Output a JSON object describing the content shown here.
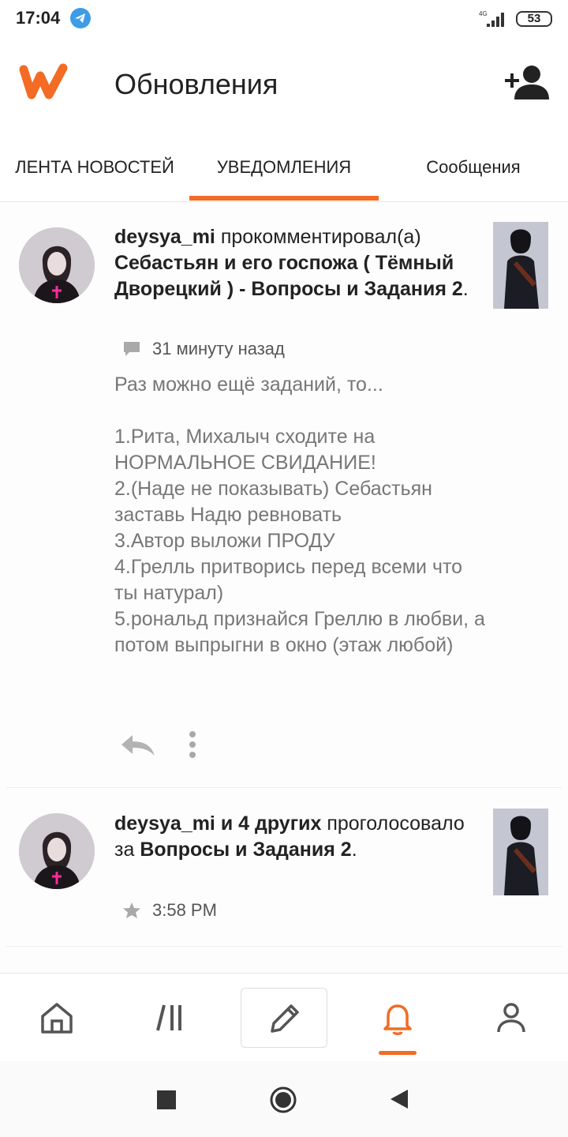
{
  "status_bar": {
    "time": "17:04",
    "network": "4G",
    "battery": "53",
    "icons": [
      "telegram-icon",
      "signal-icon",
      "battery-icon"
    ]
  },
  "app_bar": {
    "title": "Обновления",
    "logo_icon": "wattpad-logo-icon",
    "action_icon": "add-user-icon"
  },
  "tabs": [
    {
      "label": "ЛЕНТА НОВОСТЕЙ",
      "active": false
    },
    {
      "label": "УВЕДОМЛЕНИЯ",
      "active": true
    },
    {
      "label": "Сообщения",
      "active": false
    }
  ],
  "colors": {
    "accent": "#f36b24",
    "text": "#222222",
    "muted_text": "#777777"
  },
  "notifications": [
    {
      "user": "deysya_mi",
      "action": " прокомментировал(а) ",
      "target": "Себастьян и его госпожа ( Тёмный Дворецкий ) - Вопросы и Задания 2",
      "suffix": ".",
      "meta_icon": "comment-icon",
      "time": "31 минуту назад",
      "comment": "Раз можно ещё заданий, то...\n\n1.Рита, Михалыч сходите на НОРМАЛЬНОЕ СВИДАНИЕ!\n2.(Наде не показывать) Себастьян заставь Надю ревновать\n3.Автор выложи ПРОДУ\n4.Грелль притворись перед всеми что ты натурал)\n5.рональд признайся Греллю в любви, а потом выпрыгни в окно (этаж любой)",
      "actions": [
        "reply-icon",
        "more-vertical-icon"
      ]
    },
    {
      "user": "deysya_mi и 4 других",
      "action": " проголосовало за ",
      "target": "Вопросы и Задания 2",
      "suffix": ".",
      "meta_icon": "star-icon",
      "time": "3:58 PM"
    }
  ],
  "bottom_nav": [
    {
      "icon": "home-icon",
      "active": false
    },
    {
      "icon": "library-icon",
      "active": false
    },
    {
      "icon": "pencil-icon",
      "active": false
    },
    {
      "icon": "bell-icon",
      "active": true
    },
    {
      "icon": "profile-icon",
      "active": false
    }
  ],
  "system_nav": [
    "recents-square-icon",
    "home-circle-icon",
    "back-triangle-icon"
  ]
}
